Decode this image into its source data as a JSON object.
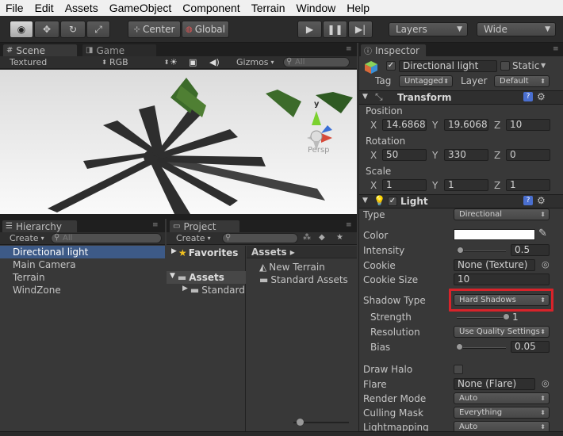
{
  "menu": [
    "File",
    "Edit",
    "Assets",
    "GameObject",
    "Component",
    "Terrain",
    "Window",
    "Help"
  ],
  "toolbar": {
    "center": "Center",
    "global": "Global",
    "layers": "Layers",
    "layout": "Wide"
  },
  "scene": {
    "tab_scene": "Scene",
    "tab_game": "Game",
    "render_mode": "Textured",
    "color_mode": "RGB",
    "gizmos": "Gizmos",
    "search_placeholder": "All",
    "persp": "Persp",
    "axis_y": "y"
  },
  "hierarchy": {
    "tab": "Hierarchy",
    "create": "Create",
    "search_placeholder": "All",
    "items": [
      "Directional light",
      "Main Camera",
      "Terrain",
      "WindZone"
    ]
  },
  "project": {
    "tab": "Project",
    "create": "Create",
    "favorites": "Favorites",
    "assets": "Assets",
    "standard": "Standard",
    "breadcrumb": "Assets ▸",
    "files": [
      "New Terrain",
      "Standard Assets"
    ]
  },
  "inspector": {
    "tab": "Inspector",
    "name": "Directional light",
    "static": "Static",
    "tag_label": "Tag",
    "tag_value": "Untagged",
    "layer_label": "Layer",
    "layer_value": "Default",
    "transform": {
      "title": "Transform",
      "position": "Position",
      "rotation": "Rotation",
      "scale": "Scale",
      "pos": {
        "x": "14.6868",
        "y": "19.60682",
        "z": "10"
      },
      "rot": {
        "x": "50",
        "y": "330",
        "z": "0"
      },
      "scl": {
        "x": "1",
        "y": "1",
        "z": "1"
      },
      "x": "X",
      "y": "Y",
      "z": "Z"
    },
    "light": {
      "title": "Light",
      "type_label": "Type",
      "type_value": "Directional",
      "color_label": "Color",
      "color_value": "#ffffff",
      "intensity_label": "Intensity",
      "intensity_value": "0.5",
      "intensity_level": 0.062,
      "cookie_label": "Cookie",
      "cookie_value": "None (Texture)",
      "cookie_size_label": "Cookie Size",
      "cookie_size_value": "10",
      "shadow_type_label": "Shadow Type",
      "shadow_type_value": "Hard Shadows",
      "strength_label": "Strength",
      "strength_value": "1",
      "strength_level": 1.0,
      "resolution_label": "Resolution",
      "resolution_value": "Use Quality Settings",
      "bias_label": "Bias",
      "bias_value": "0.05",
      "bias_level": 0.05,
      "draw_halo_label": "Draw Halo",
      "flare_label": "Flare",
      "flare_value": "None (Flare)",
      "render_mode_label": "Render Mode",
      "render_mode_value": "Auto",
      "culling_mask_label": "Culling Mask",
      "culling_mask_value": "Everything",
      "lightmapping_label": "Lightmapping",
      "lightmapping_value": "Auto"
    }
  },
  "colors": {
    "highlight": "#d8232a",
    "selection": "#3d5a87"
  }
}
